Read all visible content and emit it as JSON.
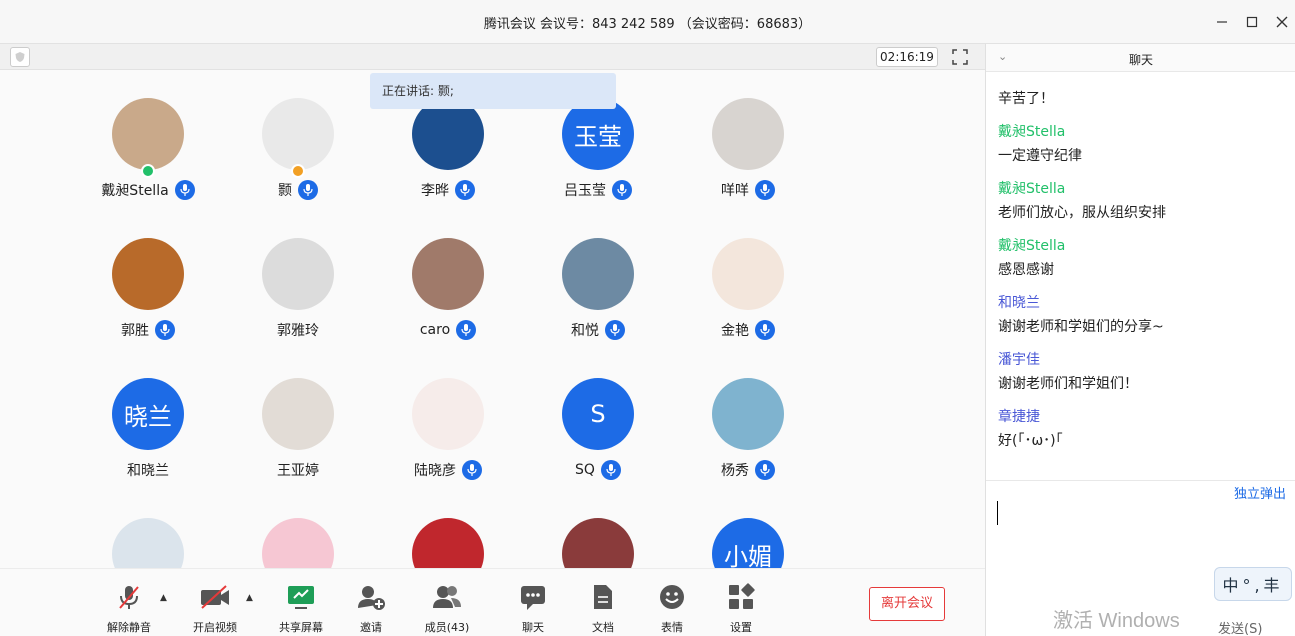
{
  "window": {
    "title": "腾讯会议 会议号：843 242 589 （会议密码：68683）"
  },
  "meeting": {
    "timer": "02:16:19",
    "speaking": "正在讲话: 颢;"
  },
  "participants": [
    {
      "name": "戴昶Stella",
      "avatar_text": "",
      "color": "#c9a98a",
      "mic": true,
      "badge": "#22c06a"
    },
    {
      "name": "颢",
      "avatar_text": "",
      "color": "#e9e9e9",
      "mic": true,
      "badge": "#f2a024"
    },
    {
      "name": "李晔",
      "avatar_text": "",
      "color": "#1c4f8f",
      "mic": true,
      "badge": ""
    },
    {
      "name": "吕玉莹",
      "avatar_text": "玉莹",
      "color": "#1d6be6",
      "mic": true,
      "badge": ""
    },
    {
      "name": "咩咩",
      "avatar_text": "",
      "color": "#d8d4d0",
      "mic": true,
      "badge": ""
    },
    {
      "name": "郭胜",
      "avatar_text": "",
      "color": "#b86a2a",
      "mic": true,
      "badge": ""
    },
    {
      "name": "郭雅玲",
      "avatar_text": "",
      "color": "#dcdcdc",
      "mic": false,
      "badge": ""
    },
    {
      "name": "caro",
      "avatar_text": "",
      "color": "#a07a6a",
      "mic": true,
      "badge": ""
    },
    {
      "name": "和悦",
      "avatar_text": "",
      "color": "#6d8aa3",
      "mic": true,
      "badge": ""
    },
    {
      "name": "金艳",
      "avatar_text": "",
      "color": "#f3e6dc",
      "mic": true,
      "badge": ""
    },
    {
      "name": "和晓兰",
      "avatar_text": "晓兰",
      "color": "#1d6be6",
      "mic": false,
      "badge": ""
    },
    {
      "name": "王亚婷",
      "avatar_text": "",
      "color": "#e2dcd6",
      "mic": false,
      "badge": ""
    },
    {
      "name": "陆晓彦",
      "avatar_text": "",
      "color": "#f6ecea",
      "mic": true,
      "badge": ""
    },
    {
      "name": "SQ",
      "avatar_text": "S",
      "color": "#1d6be6",
      "mic": true,
      "badge": ""
    },
    {
      "name": "杨秀",
      "avatar_text": "",
      "color": "#7fb3cf",
      "mic": true,
      "badge": ""
    },
    {
      "name": "",
      "avatar_text": "",
      "color": "#dbe4ec",
      "mic": false,
      "badge": ""
    },
    {
      "name": "",
      "avatar_text": "",
      "color": "#f6c7d3",
      "mic": false,
      "badge": ""
    },
    {
      "name": "",
      "avatar_text": "",
      "color": "#c0272d",
      "mic": false,
      "badge": ""
    },
    {
      "name": "",
      "avatar_text": "",
      "color": "#8a3b3b",
      "mic": false,
      "badge": ""
    },
    {
      "name": "",
      "avatar_text": "小媚",
      "color": "#1d6be6",
      "mic": false,
      "badge": ""
    }
  ],
  "toolbar": {
    "unmute": "解除静音",
    "video": "开启视频",
    "share": "共享屏幕",
    "invite": "邀请",
    "members": "成员(43)",
    "chat": "聊天",
    "docs": "文档",
    "emoji": "表情",
    "settings": "设置",
    "leave": "离开会议"
  },
  "chat": {
    "title": "聊天",
    "messages": [
      {
        "sender": "",
        "text": "辛苦了！",
        "color": "#22c06a"
      },
      {
        "sender": "戴昶Stella",
        "text": "一定遵守纪律",
        "color": "#22c06a"
      },
      {
        "sender": "戴昶Stella",
        "text": "老师们放心，服从组织安排",
        "color": "#22c06a"
      },
      {
        "sender": "戴昶Stella",
        "text": "感恩感谢",
        "color": "#22c06a"
      },
      {
        "sender": "和晓兰",
        "text": "谢谢老师和学姐们的分享~",
        "color": "#4a58d6"
      },
      {
        "sender": "潘宇佳",
        "text": "谢谢老师们和学姐们！",
        "color": "#4a58d6"
      },
      {
        "sender": "章捷捷",
        "text": "好(｢･ω･)｢",
        "color": "#4a58d6"
      }
    ],
    "popout": "独立弹出",
    "send": "发送(S)",
    "ime": "中°,丰"
  },
  "os": {
    "watermark": "激活 Windows"
  }
}
